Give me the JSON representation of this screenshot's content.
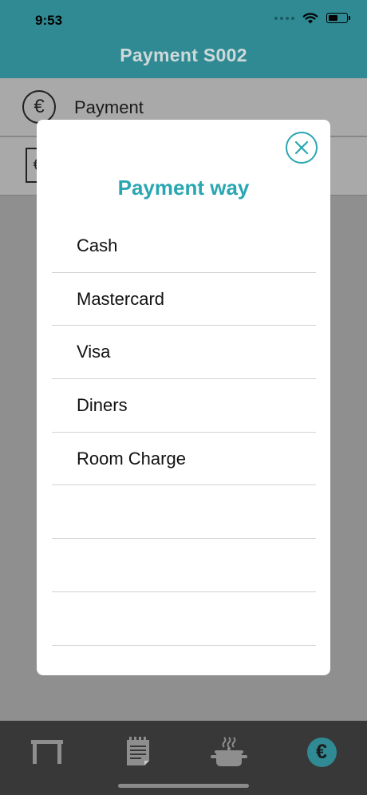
{
  "status_bar": {
    "time": "9:53"
  },
  "header": {
    "title": "Payment S002"
  },
  "background_rows": [
    {
      "label": "Payment",
      "icon": "euro-circle-icon"
    },
    {
      "label": "",
      "icon": "euro-receipt-icon"
    }
  ],
  "modal": {
    "title": "Payment way",
    "options": [
      "Cash",
      "Mastercard",
      "Visa",
      "Diners",
      "Room Charge",
      "",
      "",
      ""
    ]
  },
  "tabbar": {
    "items": [
      {
        "icon": "table-icon"
      },
      {
        "icon": "order-notepad-icon"
      },
      {
        "icon": "cooking-pot-icon"
      },
      {
        "icon": "euro-payment-icon",
        "active": true
      }
    ]
  },
  "colors": {
    "accent": "#2aa6b2",
    "header_bg": "#2f8a93",
    "tabbar_bg": "#383838",
    "overlay": "#8f8f8f"
  }
}
